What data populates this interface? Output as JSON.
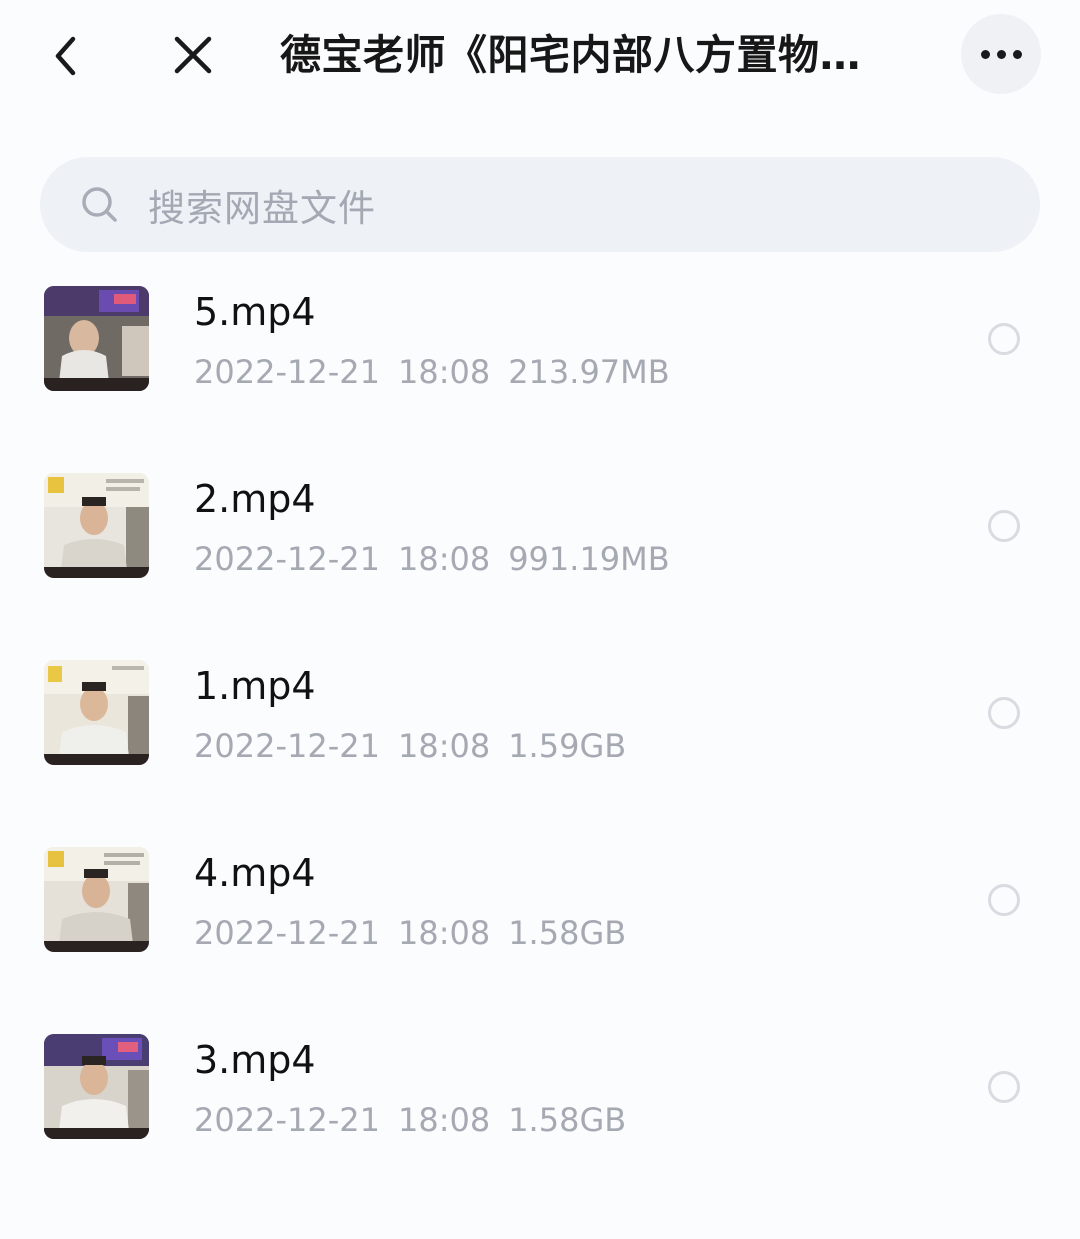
{
  "header": {
    "title": "德宝老师《阳宅内部八方置物…",
    "back_icon": "chevron-left-icon",
    "close_icon": "close-icon",
    "more_icon": "more-dots-icon"
  },
  "search": {
    "placeholder": "搜索网盘文件",
    "icon": "search-icon"
  },
  "files": [
    {
      "name": "5.mp4",
      "date": "2022-12-21",
      "time": "18:08",
      "size": "213.97MB"
    },
    {
      "name": "2.mp4",
      "date": "2022-12-21",
      "time": "18:08",
      "size": "991.19MB"
    },
    {
      "name": "1.mp4",
      "date": "2022-12-21",
      "time": "18:08",
      "size": "1.59GB"
    },
    {
      "name": "4.mp4",
      "date": "2022-12-21",
      "time": "18:08",
      "size": "1.58GB"
    },
    {
      "name": "3.mp4",
      "date": "2022-12-21",
      "time": "18:08",
      "size": "1.58GB"
    }
  ],
  "colors": {
    "background": "#fbfcfe",
    "search_bg": "#eef1f6",
    "meta_text": "#a5a9b2",
    "radio_border": "#d9dbe0"
  }
}
